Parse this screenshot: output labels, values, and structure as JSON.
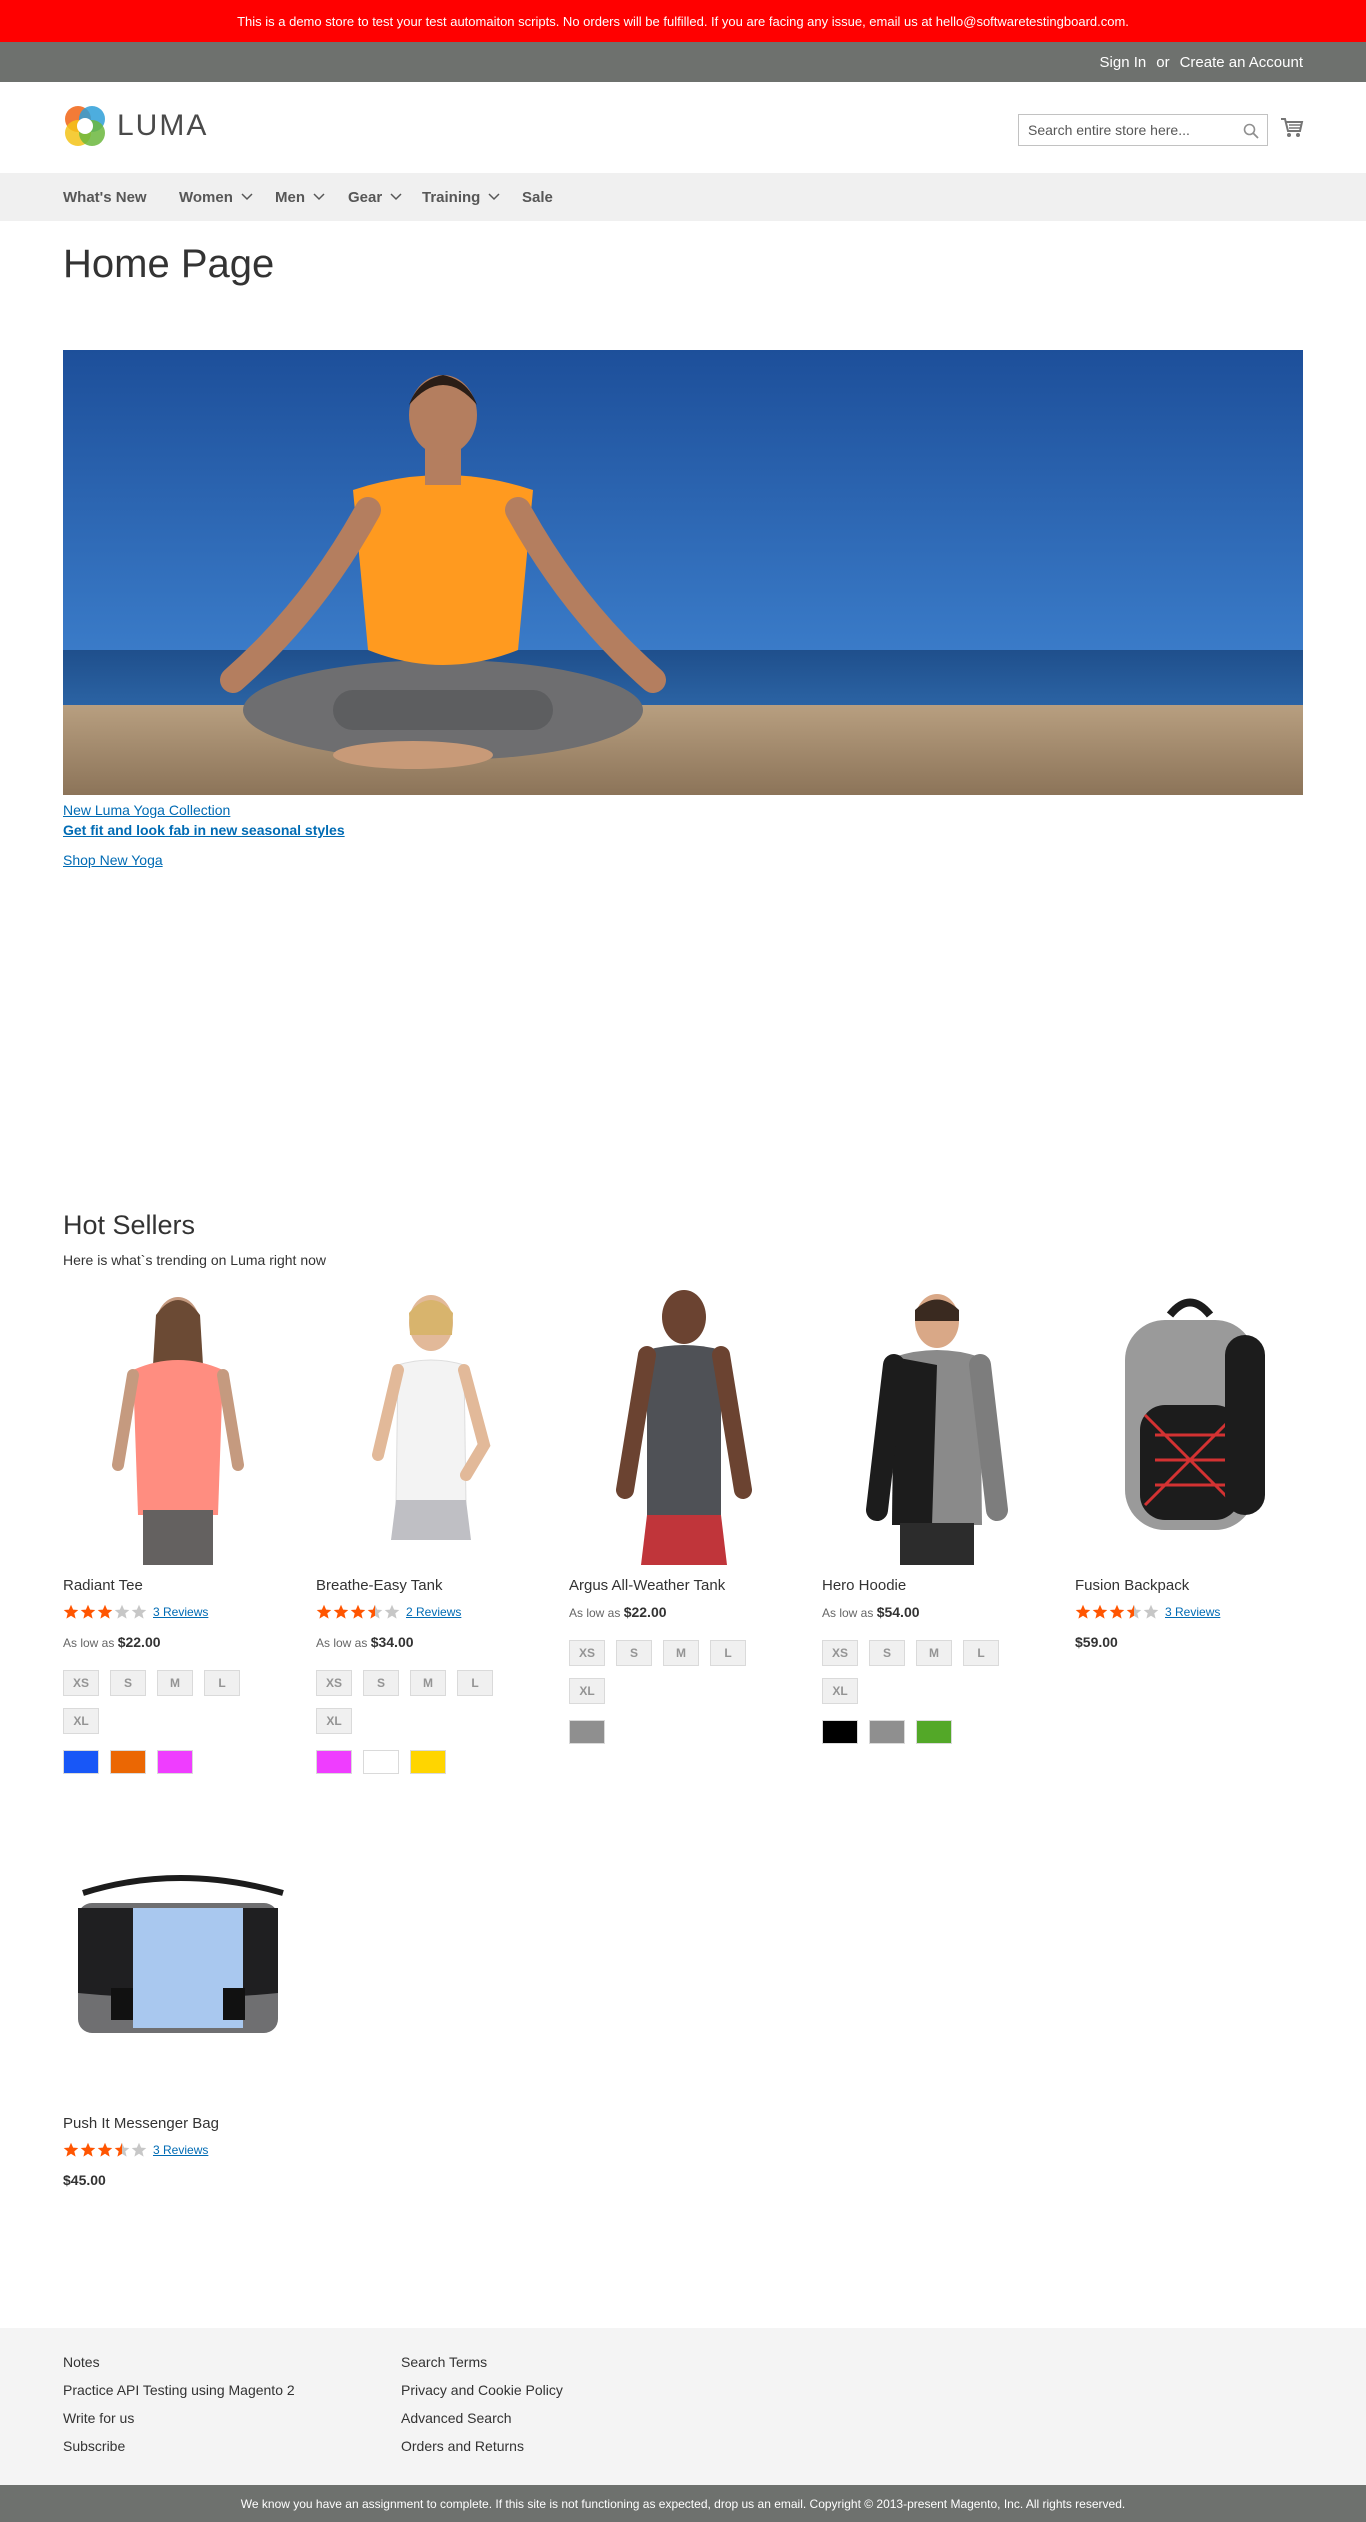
{
  "notice": "This is a demo store to test your test automaiton scripts. No orders will be fulfilled. If you are facing any issue, email us at hello@softwaretestingboard.com.",
  "header": {
    "sign_in": "Sign In",
    "or": "or",
    "create_account": "Create an Account"
  },
  "logo": {
    "text": "LUMA"
  },
  "search": {
    "placeholder": "Search entire store here...",
    "value": ""
  },
  "nav": {
    "items": [
      {
        "label": "What's New"
      },
      {
        "label": "Women"
      },
      {
        "label": "Men"
      },
      {
        "label": "Gear"
      },
      {
        "label": "Training"
      },
      {
        "label": "Sale"
      }
    ]
  },
  "page_title": "Home Page",
  "hero": {
    "link1": "New Luma Yoga Collection",
    "link2": "Get fit and look fab in new seasonal styles",
    "link3": "Shop New Yoga"
  },
  "hot_sellers": {
    "title": "Hot Sellers",
    "subtitle": "Here is what`s trending on Luma right now",
    "products": [
      {
        "name": "Radiant Tee",
        "rating": 3,
        "reviews": "3 Reviews",
        "price_label": "As low as",
        "price": "$22.00",
        "sizes": [
          "XS",
          "S",
          "M",
          "L",
          "XL"
        ],
        "colors": [
          "#1857f7",
          "#eb6703",
          "#ef3dff"
        ]
      },
      {
        "name": "Breathe-Easy Tank",
        "rating": 3.5,
        "reviews": "2 Reviews",
        "price_label": "As low as",
        "price": "$34.00",
        "sizes": [
          "XS",
          "S",
          "M",
          "L",
          "XL"
        ],
        "colors": [
          "#ef3dff",
          "#ffffff",
          "#ffd500"
        ]
      },
      {
        "name": "Argus All-Weather Tank",
        "rating": 0,
        "reviews": "",
        "price_label": "As low as",
        "price": "$22.00",
        "sizes": [
          "XS",
          "S",
          "M",
          "L",
          "XL"
        ],
        "colors": [
          "#8f8f8f"
        ]
      },
      {
        "name": "Hero Hoodie",
        "rating": 0,
        "reviews": "",
        "price_label": "As low as",
        "price": "$54.00",
        "sizes": [
          "XS",
          "S",
          "M",
          "L",
          "XL"
        ],
        "colors": [
          "#000000",
          "#8f8f8f",
          "#53a828"
        ]
      },
      {
        "name": "Fusion Backpack",
        "rating": 3.5,
        "reviews": "3 Reviews",
        "price_label": "",
        "price": "$59.00",
        "sizes": [],
        "colors": []
      },
      {
        "name": "Push It Messenger Bag",
        "rating": 3.5,
        "reviews": "3 Reviews",
        "price_label": "",
        "price": "$45.00",
        "sizes": [],
        "colors": []
      }
    ]
  },
  "footer": {
    "col1": [
      "Notes",
      "Practice API Testing using Magento 2",
      "Write for us",
      "Subscribe"
    ],
    "col2": [
      "Search Terms",
      "Privacy and Cookie Policy",
      "Advanced Search",
      "Orders and Returns"
    ]
  },
  "copyright": "We know you have an assignment to complete. If this site is not functioning as expected, drop us an email. Copyright © 2013-present Magento, Inc. All rights reserved.",
  "colors": {
    "notice_bg": "#ff0000",
    "header_bg": "#6e716e",
    "link": "#006bb4",
    "star": "#ff5501"
  }
}
